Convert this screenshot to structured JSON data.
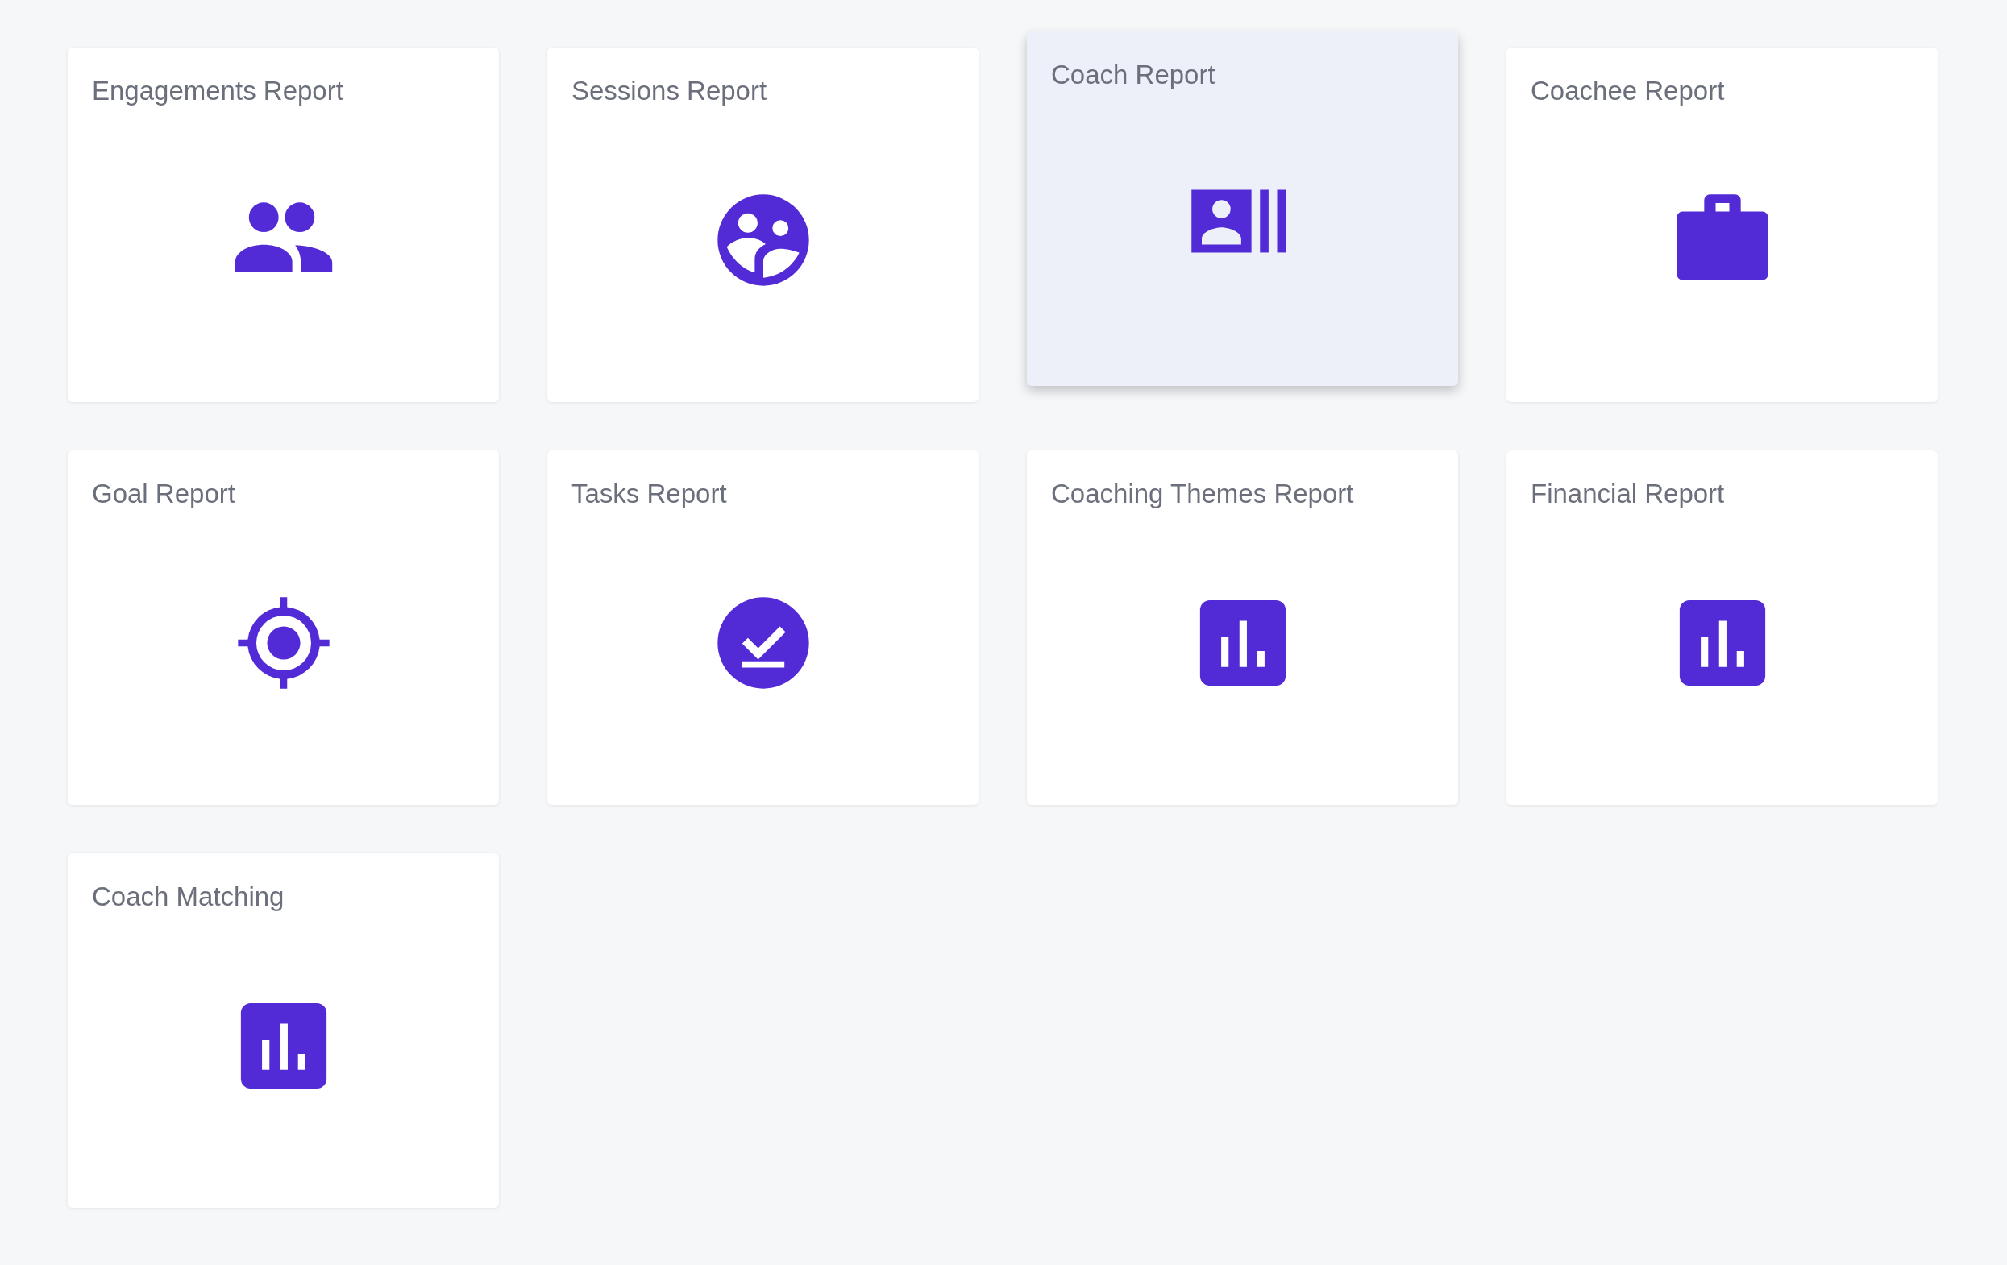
{
  "report_cards": [
    {
      "title": "Engagements Report",
      "selected": false
    },
    {
      "title": "Sessions Report",
      "selected": false
    },
    {
      "title": "Coach Report",
      "selected": true
    },
    {
      "title": "Coachee Report",
      "selected": false
    },
    {
      "title": "Goal Report",
      "selected": false
    },
    {
      "title": "Tasks Report",
      "selected": false
    },
    {
      "title": "Coaching Themes Report",
      "selected": false
    },
    {
      "title": "Financial Report",
      "selected": false
    },
    {
      "title": "Coach Matching",
      "selected": false
    }
  ]
}
